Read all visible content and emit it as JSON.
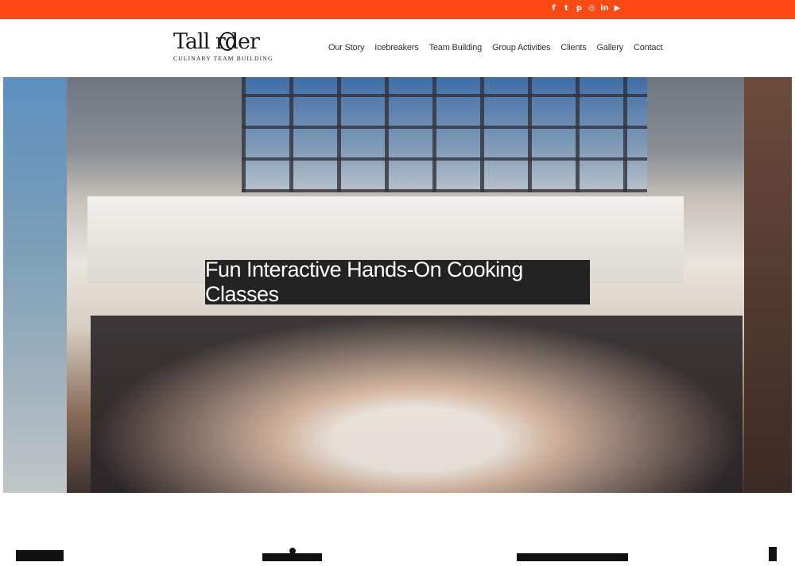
{
  "social_icons": [
    "facebook-icon",
    "twitter-icon",
    "pinterest-icon",
    "instagram-icon",
    "linkedin-icon",
    "youtube-icon"
  ],
  "social_glyphs": [
    "f",
    "t",
    "p",
    "◎",
    "in",
    "▶"
  ],
  "logo": {
    "text": "Tall rder",
    "tagline": "CULINARY TEAM BUILDING"
  },
  "nav": {
    "items": [
      "Our Story",
      "Icebreakers",
      "Team Building",
      "Group Activities",
      "Clients",
      "Gallery",
      "Contact"
    ]
  },
  "hero": {
    "caption": "Fun Interactive Hands-On Cooking Classes"
  },
  "colors": {
    "topbar": "#fd4a14",
    "caption_bg": "#232323"
  }
}
